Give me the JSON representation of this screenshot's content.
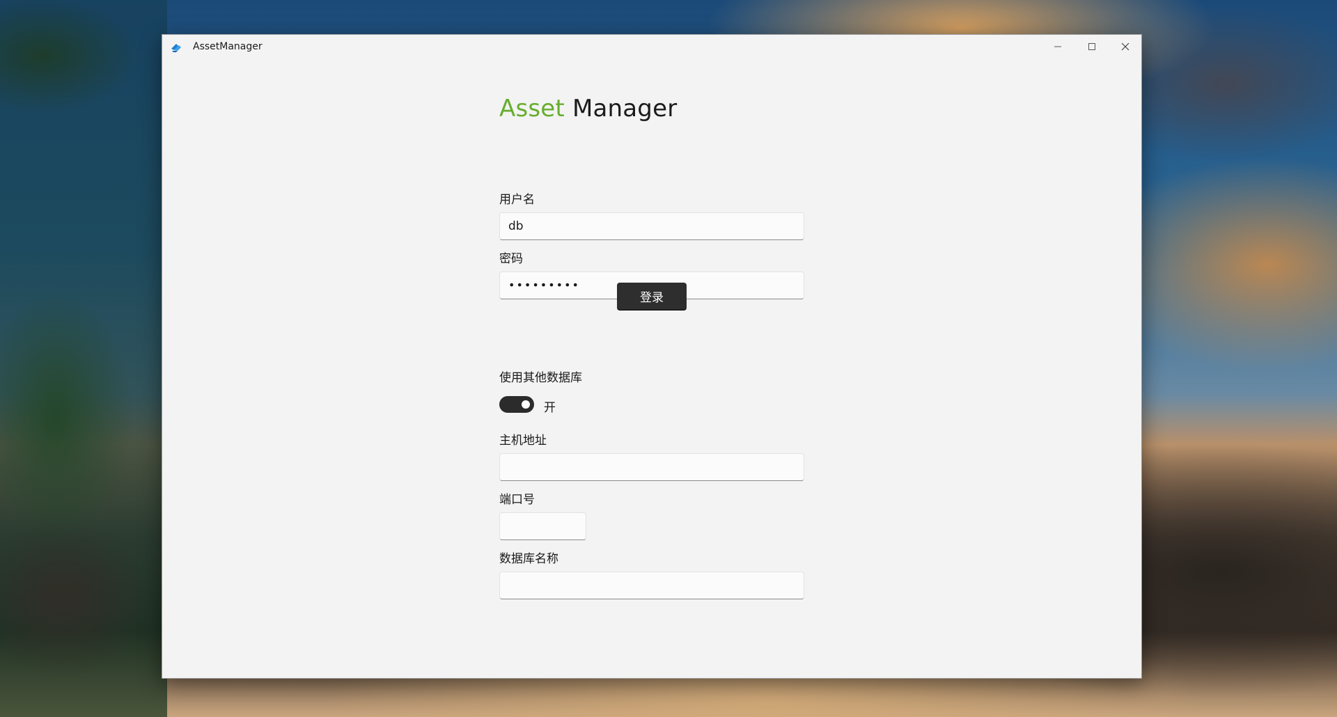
{
  "window": {
    "title": "AssetManager"
  },
  "titlebar": {
    "app_icon": "asset-manager-logo",
    "minimize_icon": "minimize-icon",
    "maximize_icon": "maximize-icon",
    "close_icon": "close-icon"
  },
  "heading": {
    "accent": "Asset",
    "rest": "Manager",
    "accent_color": "#67ad2e"
  },
  "form": {
    "username": {
      "label": "用户名",
      "value": "db"
    },
    "password": {
      "label": "密码",
      "masked_value": "•••••••••"
    },
    "login_button": "登录",
    "use_other_db": {
      "label": "使用其他数据库",
      "toggle_state": "开",
      "on": true
    },
    "host": {
      "label": "主机地址",
      "value": ""
    },
    "port": {
      "label": "端口号",
      "value": ""
    },
    "db_name": {
      "label": "数据库名称",
      "value": ""
    }
  }
}
